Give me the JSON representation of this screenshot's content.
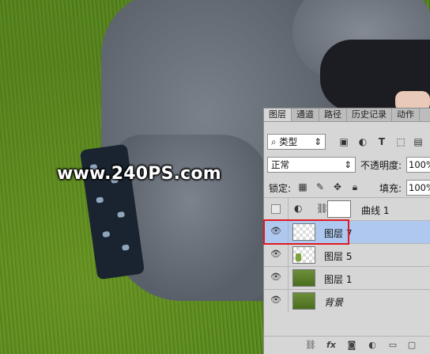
{
  "watermark": "www.240PS.com",
  "panel": {
    "tabs": [
      "图层",
      "通道",
      "路径",
      "历史记录",
      "动作"
    ],
    "filter": {
      "label": "类型"
    },
    "blend_mode": "正常",
    "opacity": {
      "label": "不透明度:",
      "value": "100%"
    },
    "lock": {
      "label": "锁定:"
    },
    "fill": {
      "label": "填充:",
      "value": "100%"
    },
    "layers": [
      {
        "name": "曲线 1",
        "visible": false,
        "type": "adjustment"
      },
      {
        "name": "图层 7",
        "visible": true,
        "selected": true,
        "highlighted": true
      },
      {
        "name": "图层 5",
        "visible": true
      },
      {
        "name": "图层 1",
        "visible": true
      },
      {
        "name": "背景",
        "visible": true,
        "italic": true
      }
    ]
  },
  "colors": {
    "highlight": "#e01a22",
    "selected_row": "#aec8ef",
    "panel_bg": "#d6d6d6"
  }
}
